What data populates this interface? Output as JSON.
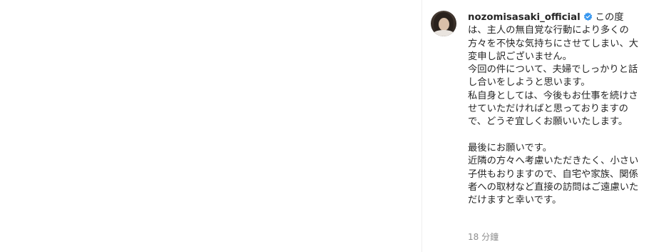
{
  "post": {
    "username": "nozomisasaki_official",
    "caption": "この度は、主人の無自覚な行動により多くの方々を不快な気持ちにさせてしまい、大変申し訳ございません。\n今回の件について、夫婦でしっかりと話し合いをしようと思います。\n私自身としては、今後もお仕事を続けさせていただければと思っておりますので、どうぞ宜しくお願いいたします。\n\n最後にお願いです。\n近隣の方々へ考慮いただきたく、小さい子供もおりますので、自宅や家族、関係者への取材など直接の訪問はご遠慮いただけますと幸いです。",
    "timestamp": "18 分鐘",
    "verified_icon": "verified-badge-icon",
    "verified_color": "#3897f0",
    "avatar_icon": "profile-avatar"
  }
}
